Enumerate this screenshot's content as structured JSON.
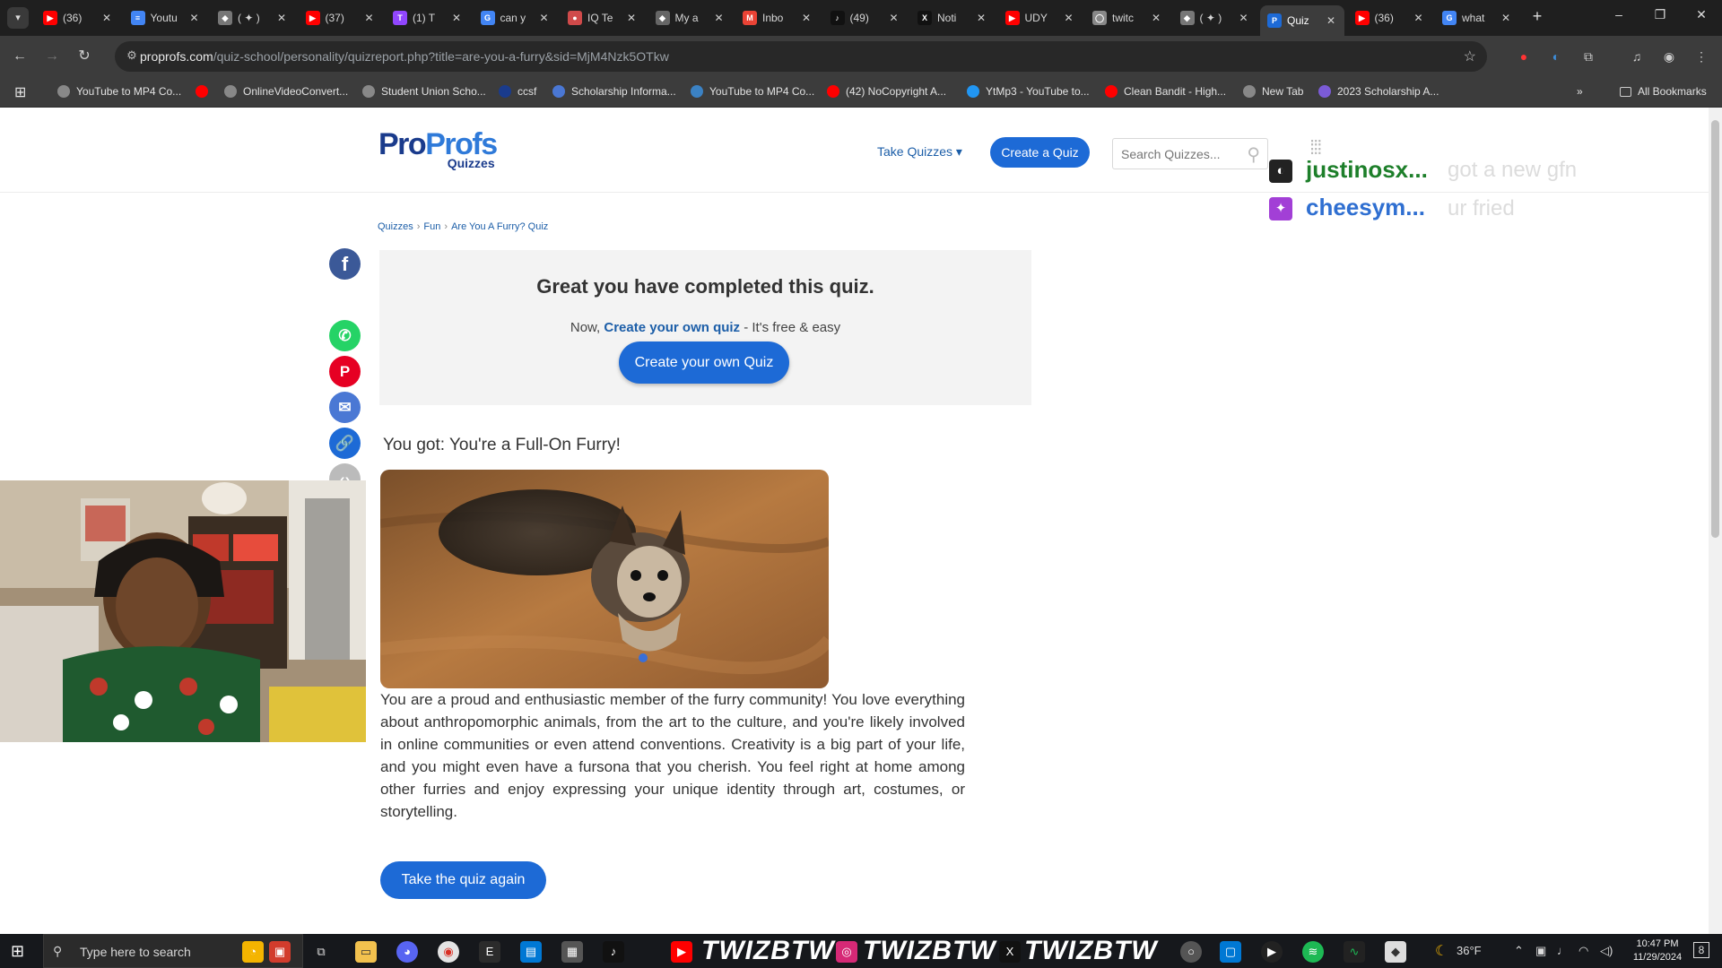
{
  "browser": {
    "tabs": [
      {
        "title": "(36)",
        "color": "#ff0000",
        "glyph": "▶"
      },
      {
        "title": "Youtu",
        "color": "#4285f4",
        "glyph": "≡"
      },
      {
        "title": "( ✦ )",
        "color": "#777777",
        "glyph": "◆"
      },
      {
        "title": "(37)",
        "color": "#ff0000",
        "glyph": "▶"
      },
      {
        "title": "(1) T",
        "color": "#9146ff",
        "glyph": "T"
      },
      {
        "title": "can y",
        "color": "#4285f4",
        "glyph": "G"
      },
      {
        "title": "IQ Te",
        "color": "#d04a4a",
        "glyph": "●"
      },
      {
        "title": "My a",
        "color": "#666666",
        "glyph": "◆"
      },
      {
        "title": "Inbo",
        "color": "#ea4335",
        "glyph": "M"
      },
      {
        "title": "(49)",
        "color": "#111111",
        "glyph": "♪"
      },
      {
        "title": "Noti",
        "color": "#111111",
        "glyph": "X"
      },
      {
        "title": "UDY",
        "color": "#ff0000",
        "glyph": "▶"
      },
      {
        "title": "twitc",
        "color": "#888888",
        "glyph": "◯"
      },
      {
        "title": "( ✦ )",
        "color": "#777777",
        "glyph": "◆"
      },
      {
        "title": "Quiz",
        "color": "#1d6ad6",
        "glyph": "P",
        "active": true
      },
      {
        "title": "(36)",
        "color": "#ff0000",
        "glyph": "▶"
      },
      {
        "title": "what",
        "color": "#4285f4",
        "glyph": "G"
      }
    ],
    "url_host": "proprofs.com",
    "url_path": "/quiz-school/personality/quizreport.php?title=are-you-a-furry&sid=MjM4Nzk5OTkw",
    "bookmarks": [
      {
        "label": "YouTube to MP4 Co...",
        "color": "#888888"
      },
      {
        "label": "",
        "color": "#ff0000"
      },
      {
        "label": "OnlineVideoConvert...",
        "color": "#888888"
      },
      {
        "label": "Student Union Scho...",
        "color": "#888888"
      },
      {
        "label": "ccsf",
        "color": "#1a3b8c"
      },
      {
        "label": "Scholarship Informa...",
        "color": "#4a77d4"
      },
      {
        "label": "YouTube to MP4 Co...",
        "color": "#3b82c4"
      },
      {
        "label": "(42) NoCopyright A...",
        "color": "#ff0000"
      },
      {
        "label": "YtMp3 - YouTube to...",
        "color": "#2196f3"
      },
      {
        "label": "Clean Bandit - High...",
        "color": "#ff0000"
      },
      {
        "label": "New Tab",
        "color": "#888888"
      },
      {
        "label": "2023 Scholarship A...",
        "color": "#7b5bd6"
      }
    ],
    "all_bookmarks": "All Bookmarks"
  },
  "site": {
    "logo_pro": "Pro",
    "logo_profs": "Profs",
    "logo_sub": "Quizzes",
    "take_quizzes": "Take Quizzes ▾",
    "create_quiz": "Create a Quiz",
    "search_placeholder": "Search Quizzes..."
  },
  "stream_overlay": {
    "user1": "justinosx...",
    "msg1": "got a new gfn",
    "user2": "cheesym...",
    "msg2": "ur fried"
  },
  "breadcrumb": [
    "Quizzes",
    "Fun",
    "Are You A Furry? Quiz"
  ],
  "completed": {
    "heading": "Great you have completed this quiz.",
    "sub_prefix": "Now, ",
    "sub_link": "Create your own quiz",
    "sub_suffix": " - It's free & easy",
    "button": "Create your own Quiz"
  },
  "result": {
    "title": "You got: You're a Full-On Furry!",
    "description": "You are a proud and enthusiastic member of the furry community! You love everything about anthropomorphic animals, from the art to the culture, and you're likely involved in online communities or even attend conventions. Creativity is a big part of your life, and you might even have a fursona that you cherish. You feel right at home among other furries and enjoy expressing your unique identity through art, costumes, or storytelling.",
    "again_button": "Take the quiz again"
  },
  "taskbar": {
    "search_placeholder": "Type here to search",
    "handle": "TWIZBTW",
    "weather": "36°F",
    "time": "10:47 PM",
    "date": "11/29/2024",
    "notifications": "8"
  }
}
